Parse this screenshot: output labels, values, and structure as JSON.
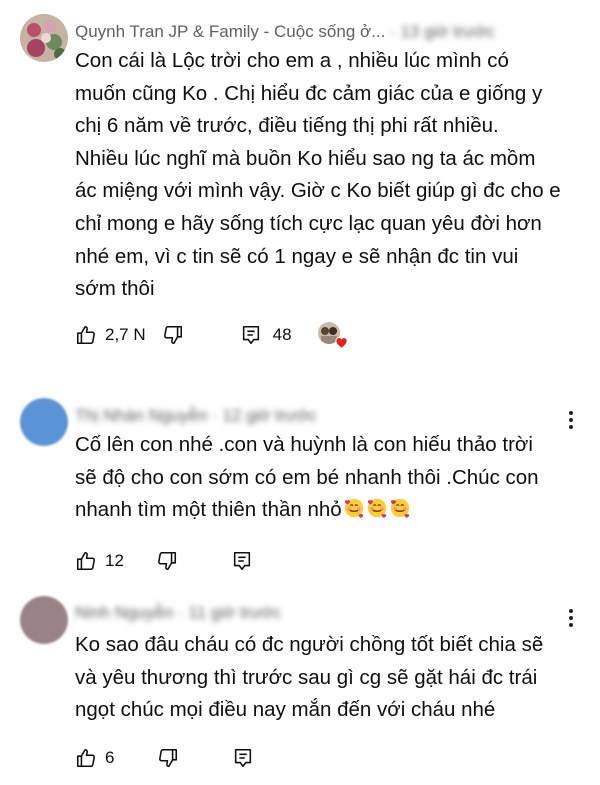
{
  "comments": [
    {
      "author": "Quynh Tran JP & Family - Cuộc sống ở...",
      "time": "13 giờ trước",
      "text": "Con cái là Lộc trời cho em a , nhiều lúc mình có\nmuốn cũng Ko . Chị hiểu đc cảm giác của e giống y\nchị 6  năm về trước, điều tiếng thị phi rất nhiều.\nNhiều lúc nghĩ mà buồn Ko hiểu sao ng ta ác mồm\nác miệng với mình vậy. Giờ c Ko biết giúp gì đc cho e\nchỉ mong e hãy sống tích cực lạc quan yêu đời hơn\nnhé em, vì c tin sẽ có 1 ngay e sẽ nhận đc tin vui\nsớm thôi",
      "likes": "2,7 N",
      "replies": "48"
    },
    {
      "author": "Thị Nhàn Nguyễn",
      "time": "12 giờ trước",
      "text": "Cố lên con nhé .con và huỳnh là con hiếu thảo trời\nsẽ độ cho con sớm có em bé nhanh thôi .Chúc con\nnhanh tìm một thiên thần nhỏ",
      "likes": "12"
    },
    {
      "author": "Ninh Nguyễn",
      "time": "11 giờ trước",
      "text": "Ko sao đâu cháu có đc người chồng tốt biết chia sẽ\nvà yêu thương thì trước sau gì cg sẽ gặt hái đc trái\nngọt chúc mọi điều nay mắn đến với cháu nhé",
      "likes": "6"
    }
  ],
  "icons": {
    "like": "thumbs-up-icon",
    "dislike": "thumbs-down-icon",
    "reply": "reply-comment-icon",
    "more": "more-vert-icon",
    "emoji": "smiling-face-with-hearts"
  },
  "colors": {
    "heart": "#e62117",
    "secondary_text": "#606060",
    "avatar_blue": "#5b94d6",
    "avatar_mauve": "#9a8386"
  }
}
